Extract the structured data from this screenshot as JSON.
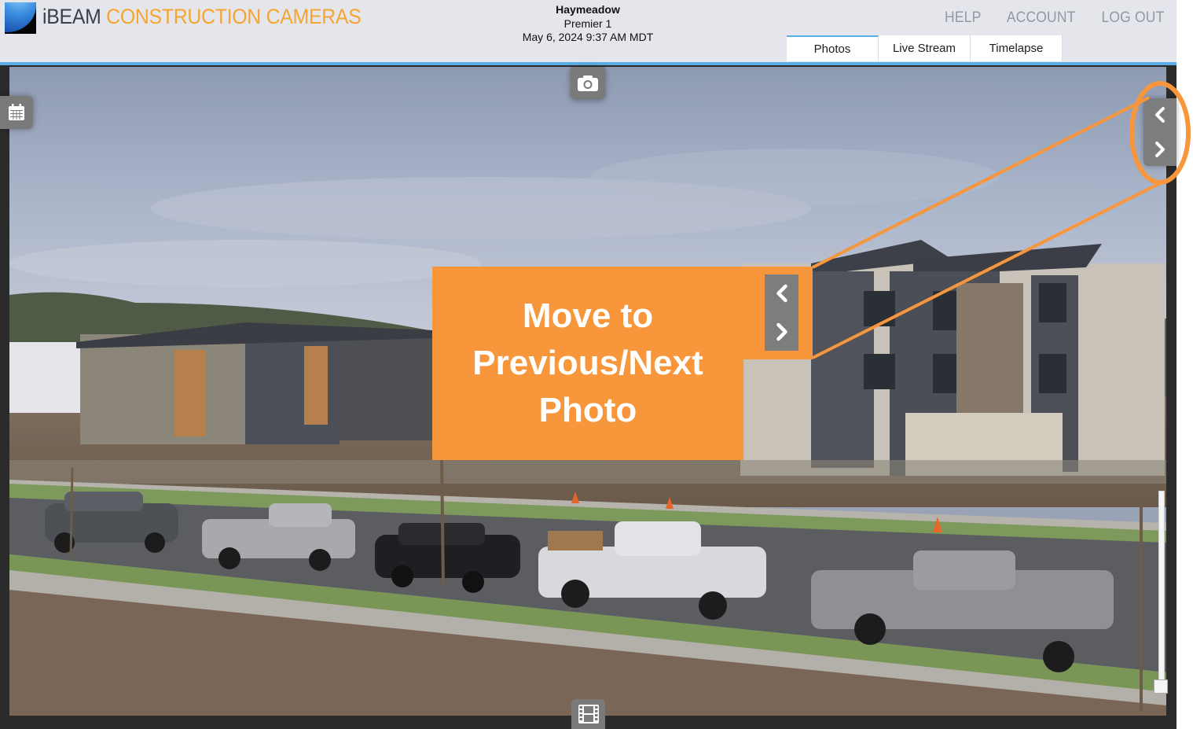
{
  "header": {
    "brand_primary": "iBEAM",
    "brand_secondary": "CONSTRUCTION CAMERAS",
    "site_name": "Haymeadow",
    "camera_name": "Premier 1",
    "timestamp": "May 6, 2024 9:37 AM MDT",
    "nav_links": [
      {
        "label": "HELP"
      },
      {
        "label": "ACCOUNT"
      },
      {
        "label": "LOG OUT"
      }
    ],
    "tabs": [
      {
        "label": "Photos",
        "active": true
      },
      {
        "label": "Live Stream",
        "active": false
      },
      {
        "label": "Timelapse",
        "active": false
      }
    ]
  },
  "viewer": {
    "image_description": "Construction site photo: apartment buildings under construction, parked pickup trucks and SUVs on street, cloudy sky and hills",
    "controls": {
      "calendar_icon": "calendar-icon",
      "snapshot_icon": "camera-icon",
      "timelapse_icon": "film-icon",
      "previous_icon": "chevron-left-icon",
      "next_icon": "chevron-right-icon"
    }
  },
  "annotation": {
    "callout_text_line1": "Move to",
    "callout_text_line2": "Previous/Next",
    "callout_text_line3": "Photo",
    "highlight_color": "#f7963a"
  },
  "colors": {
    "accent_blue": "#5aaee6",
    "brand_orange": "#f5a532",
    "header_bg": "#e4e6ec",
    "control_gray": "#7a7a7a"
  }
}
